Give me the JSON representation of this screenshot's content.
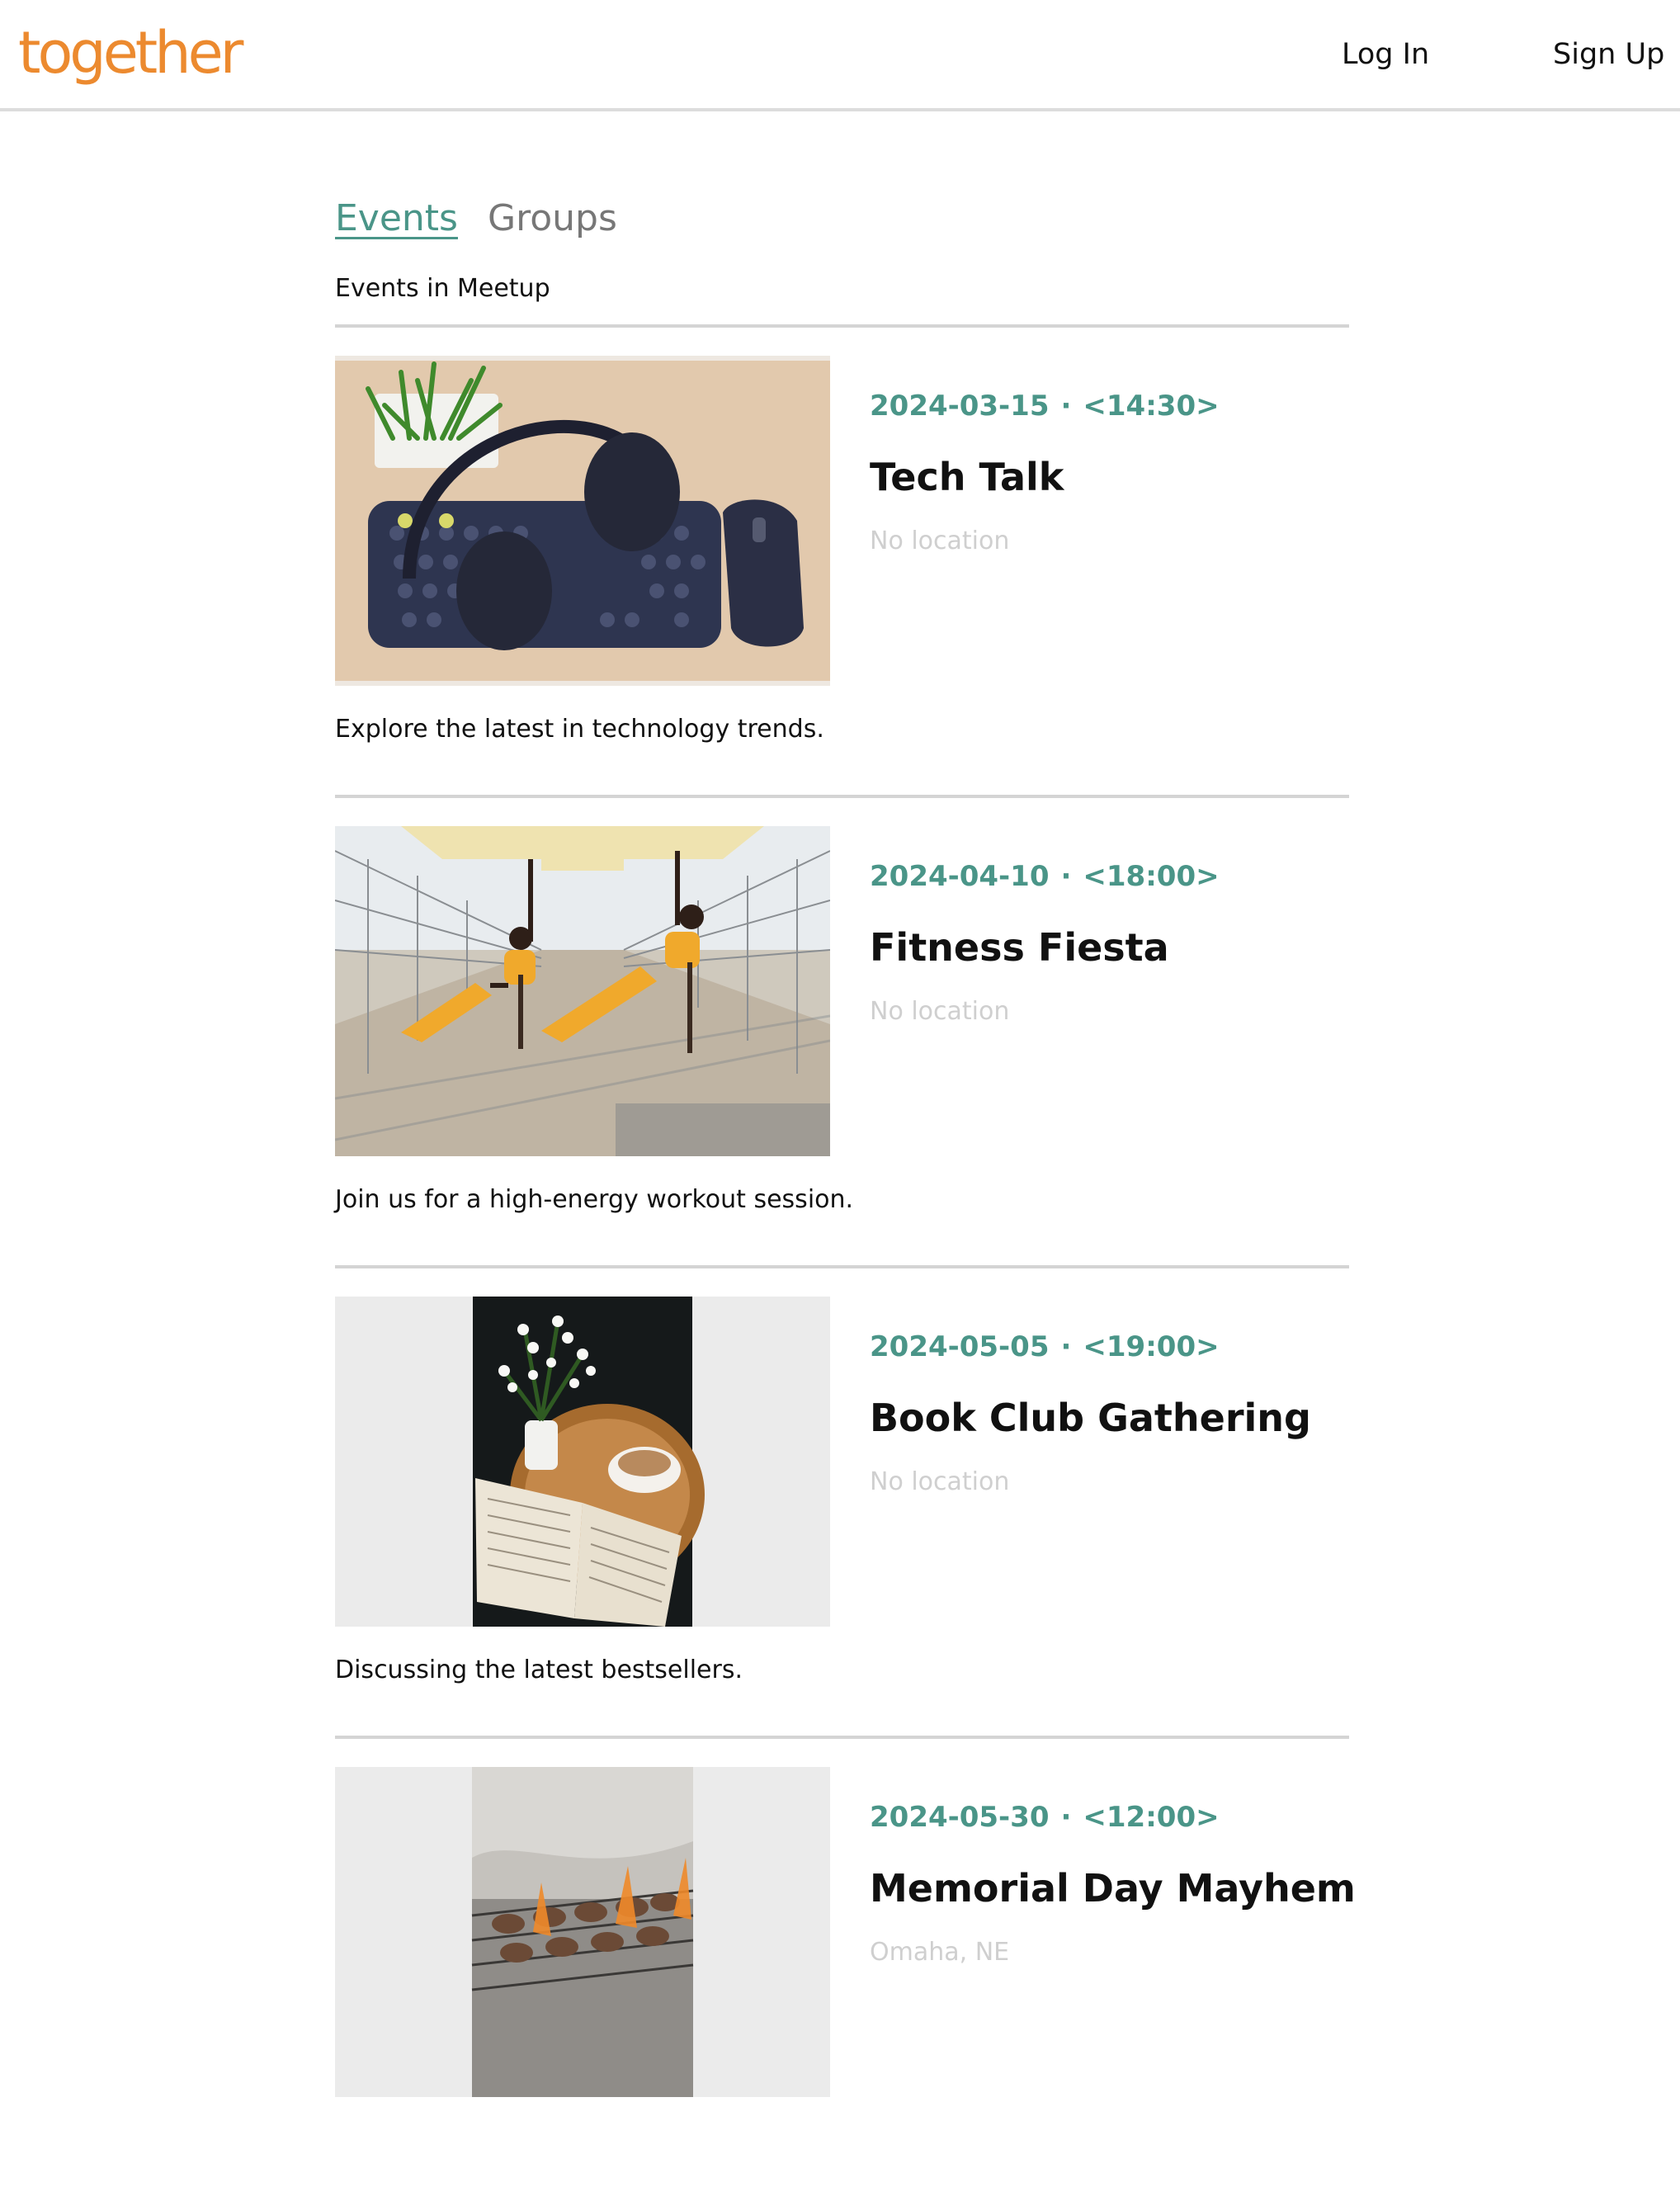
{
  "header": {
    "logo": "together",
    "login_label": "Log In",
    "signup_label": "Sign Up"
  },
  "tabs": {
    "events_label": "Events",
    "groups_label": "Groups"
  },
  "subtitle": "Events in Meetup",
  "events": [
    {
      "date": "2024-03-15",
      "separator": "·",
      "time": "<14:30>",
      "title": "Tech Talk",
      "location": "No location",
      "description": "Explore the latest in technology trends.",
      "image": "keyboard-headphones-mouse-photo"
    },
    {
      "date": "2024-04-10",
      "separator": "·",
      "time": "<18:00>",
      "title": "Fitness Fiesta",
      "location": "No location",
      "description": "Join us for a high-energy workout session.",
      "image": "side-plank-workout-photo"
    },
    {
      "date": "2024-05-05",
      "separator": "·",
      "time": "<19:00>",
      "title": "Book Club Gathering",
      "location": "No location",
      "description": "Discussing the latest bestsellers.",
      "image": "book-coffee-flowers-photo"
    },
    {
      "date": "2024-05-30",
      "separator": "·",
      "time": "<12:00>",
      "title": "Memorial Day Mayhem",
      "location": "Omaha, NE",
      "description": "",
      "image": "grill-burgers-photo"
    }
  ],
  "colors": {
    "brand": "#ec8a2f",
    "accent": "#4a9588",
    "muted": "#777777",
    "location": "#cfcfcf",
    "divider": "#d4d4d4"
  }
}
